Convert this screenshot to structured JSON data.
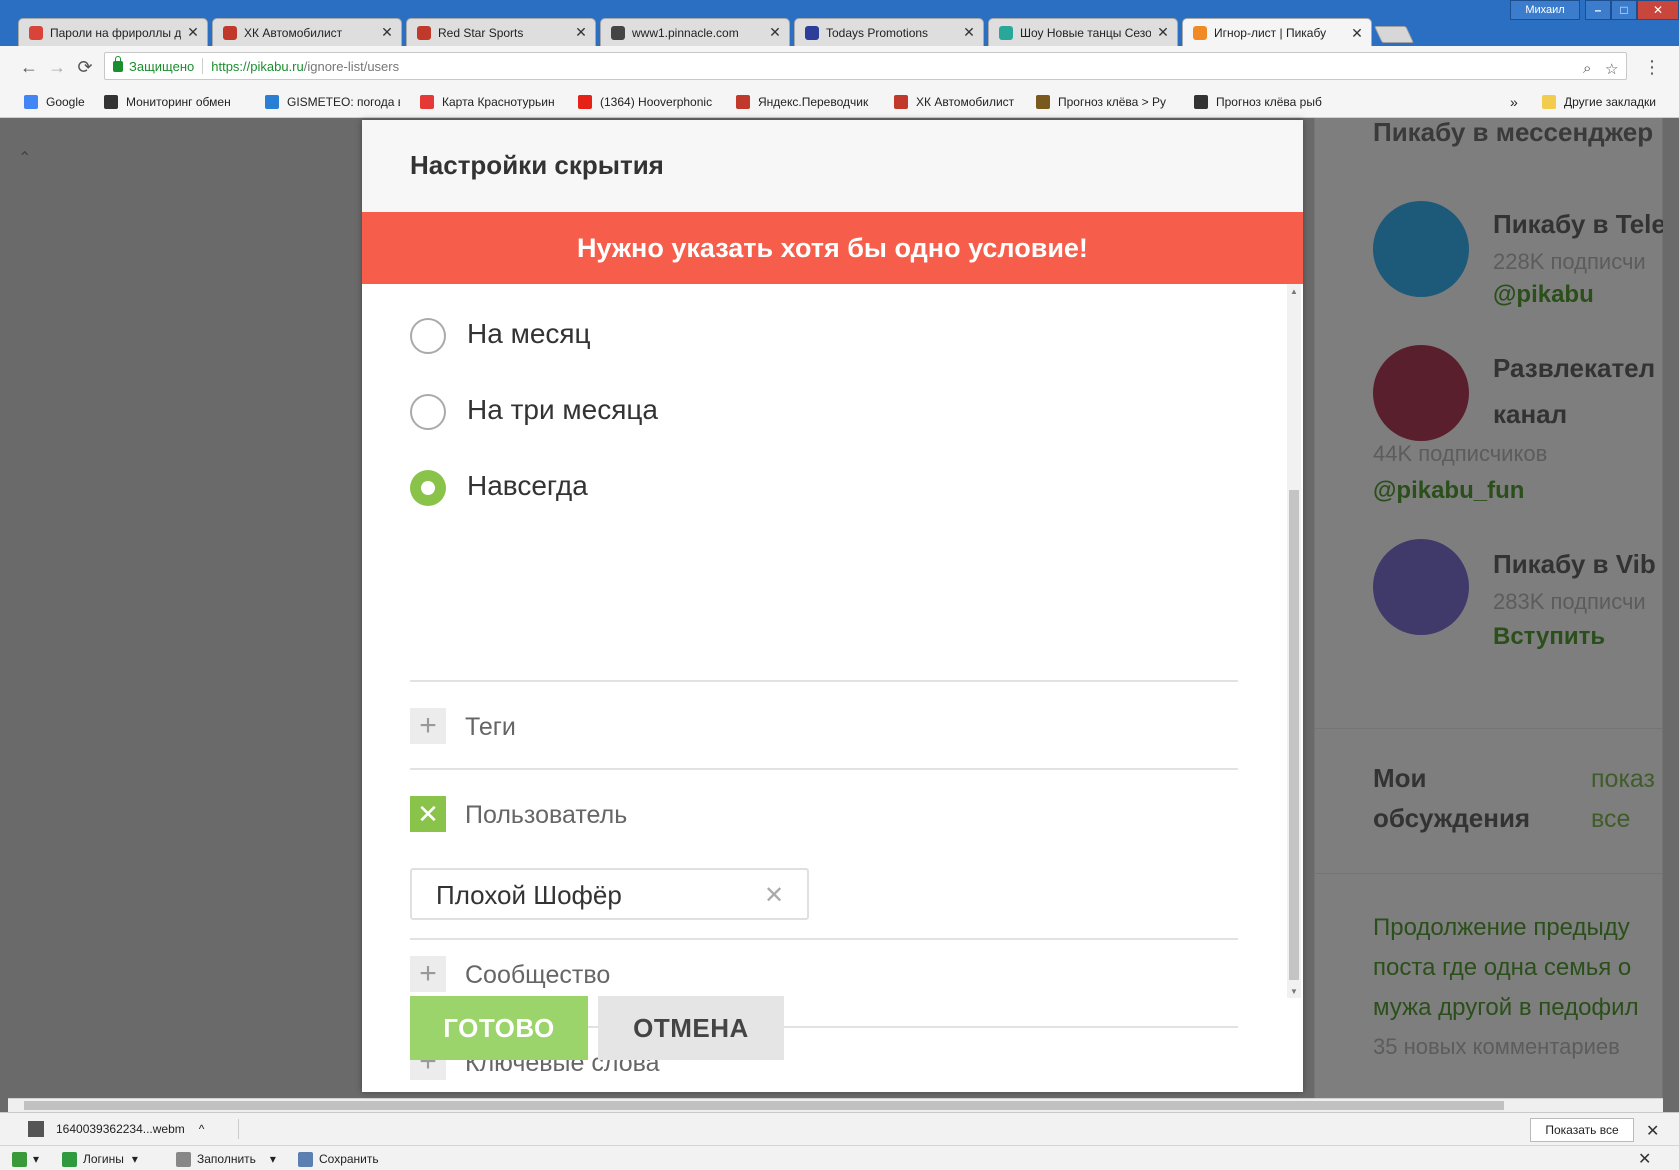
{
  "window": {
    "user": "Михаил",
    "minimize_label": "–",
    "maximize_label": "□",
    "close_label": "✕"
  },
  "tabs": [
    {
      "title": "Пароли на фрироллы д",
      "favicon_color": "#d9443a",
      "active": false
    },
    {
      "title": "ХК Автомобилист",
      "favicon_color": "#c0392b",
      "active": false
    },
    {
      "title": "Red Star Sports",
      "favicon_color": "#c0392b",
      "active": false
    },
    {
      "title": "www1.pinnacle.com",
      "favicon_color": "#444444",
      "active": false
    },
    {
      "title": "Todays Promotions",
      "favicon_color": "#2c3e9a",
      "active": false
    },
    {
      "title": "Шоу Новые танцы Сезо",
      "favicon_color": "#2aa79b",
      "active": false
    },
    {
      "title": "Игнор-лист | Пикабу",
      "favicon_color": "#f08a24",
      "active": true
    }
  ],
  "tab_close_glyph": "✕",
  "toolbar": {
    "back_icon": "←",
    "forward_icon": "→",
    "reload_icon": "⟳",
    "secure_label": "Защищено",
    "url_host": "https://pikabu.ru",
    "url_path": "/ignore-list/users",
    "zoom_icon": "⌕",
    "star_icon": "☆",
    "menu_icon": "⋮"
  },
  "bookmarks": [
    {
      "label": "Google",
      "color": "#4285f4"
    },
    {
      "label": "Мониторинг обмен",
      "color": "#333333"
    },
    {
      "label": "GISMETEO: погода в",
      "color": "#2a7fd4"
    },
    {
      "label": "Карта Краснотурьин",
      "color": "#e53935"
    },
    {
      "label": "(1364) Hooverphonic",
      "color": "#e62117"
    },
    {
      "label": "Яндекс.Переводчик",
      "color": "#c0392b"
    },
    {
      "label": "ХК Автомобилист",
      "color": "#c0392b"
    },
    {
      "label": "Прогноз клёва > Ру",
      "color": "#7a5a1c"
    },
    {
      "label": "Прогноз клёва рыб",
      "color": "#333333"
    }
  ],
  "bookmarks_more": "»",
  "bookmarks_other": "Другие закладки",
  "sidebar": {
    "heading": "Пикабу в мессенджер",
    "telegram": {
      "name": "Пикабу в Tele",
      "subs": "228K подписчи",
      "link": "@pikabu"
    },
    "fun": {
      "name_line1": "Развлекател",
      "name_line2": "канал",
      "subs": "44K подписчиков",
      "link": "@pikabu_fun"
    },
    "viber": {
      "name": "Пикабу в Vib",
      "subs": "283K подписчи",
      "link": "Вступить"
    },
    "discussions": {
      "title_line1": "Мои",
      "title_line2": "обсуждения",
      "show_line1": "показ",
      "show_line2": "все"
    },
    "post": {
      "line1": "Продолжение предыду",
      "line2": "поста где одна семья о",
      "line3": "мужа другой в педофил",
      "comments": "35 новых комментариев"
    },
    "colors": {
      "telegram": "#1d5a7a",
      "fun": "#5a1f2c",
      "viber": "#3f3a6a"
    }
  },
  "modal": {
    "title": "Настройки скрытия",
    "error": "Нужно указать хотя бы одно условие!",
    "durations": [
      {
        "label": "На месяц",
        "checked": false
      },
      {
        "label": "На три месяца",
        "checked": false
      },
      {
        "label": "Навсегда",
        "checked": true
      }
    ],
    "sections": {
      "tags": {
        "label": "Теги",
        "icon": "+"
      },
      "user": {
        "label": "Пользователь",
        "icon": "✕",
        "value": "Плохой Шофёр",
        "clear_icon": "✕"
      },
      "community": {
        "label": "Сообщество",
        "icon": "+"
      },
      "keywords": {
        "label": "Ключевые слова",
        "icon": "+"
      }
    },
    "ok_label": "ГОТОВО",
    "cancel_label": "ОТМЕНА",
    "scroll_up": "▲",
    "scroll_down": "▼"
  },
  "downloads": {
    "file": "1640039362234...webm",
    "chevron": "^",
    "show_all": "Показать все",
    "close": "✕"
  },
  "status": {
    "logins": "Логины",
    "fill": "Заполнить",
    "save": "Сохранить",
    "close": "✕"
  },
  "page": {
    "scroll_up": "⌃"
  },
  "accent": {
    "green": "#8ac34a",
    "error": "#f65d4a"
  }
}
